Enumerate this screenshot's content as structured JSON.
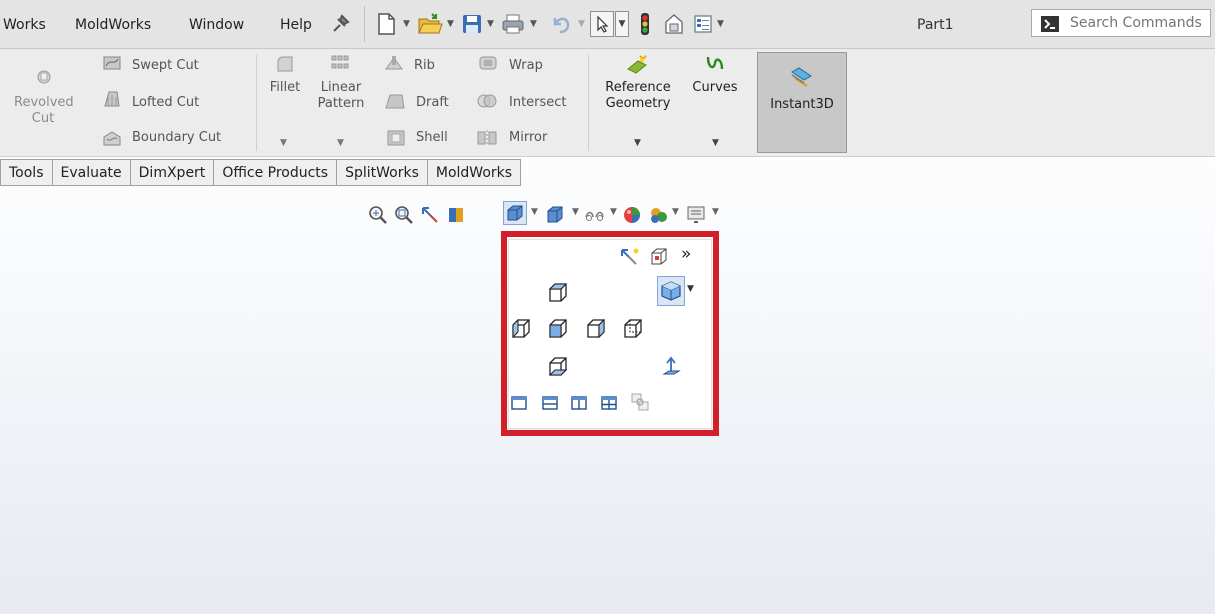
{
  "menu": [
    "Works",
    "MoldWorks",
    "Window",
    "Help"
  ],
  "document_title": "Part1",
  "search": {
    "placeholder": "Search Commands"
  },
  "ribbon": {
    "revolved_cut": "Revolved\nCut",
    "swept_cut": "Swept Cut",
    "lofted_cut": "Lofted Cut",
    "boundary_cut": "Boundary Cut",
    "fillet": "Fillet",
    "linear_pattern": "Linear\nPattern",
    "rib": "Rib",
    "draft": "Draft",
    "shell": "Shell",
    "wrap": "Wrap",
    "intersect": "Intersect",
    "mirror": "Mirror",
    "reference_geometry": "Reference\nGeometry",
    "curves": "Curves",
    "instant3d": "Instant3D"
  },
  "tabs": [
    "Tools",
    "Evaluate",
    "DimXpert",
    "Office Products",
    "SplitWorks",
    "MoldWorks"
  ],
  "heads_up_icons": [
    "zoom-to-fit-icon",
    "zoom-to-area-icon",
    "previous-view-icon",
    "section-view-icon",
    "view-orientation-icon",
    "display-style-icon",
    "hide-show-items-icon",
    "edit-appearance-icon",
    "apply-scene-icon",
    "view-settings-icon"
  ],
  "view_popup": {
    "highlight_color": "#d1202a",
    "orientation_icons": [
      "top-view-icon",
      "left-view-icon",
      "front-view-icon",
      "right-view-icon",
      "back-view-icon",
      "bottom-view-icon",
      "isometric-view-icon",
      "normal-to-icon"
    ],
    "viewport_icons": [
      "single-view-icon",
      "two-view-horizontal-icon",
      "two-view-vertical-icon",
      "four-view-icon",
      "link-views-icon"
    ]
  }
}
